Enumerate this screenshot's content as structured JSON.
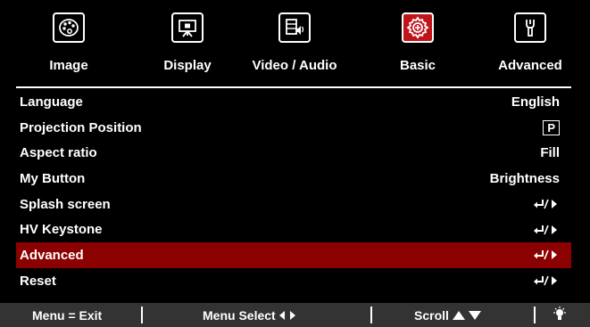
{
  "tabs": [
    {
      "label": "Image",
      "icon": "palette-icon"
    },
    {
      "label": "Display",
      "icon": "projector-screen-icon"
    },
    {
      "label": "Video / Audio",
      "icon": "video-audio-icon"
    },
    {
      "label": "Basic",
      "icon": "gear-icon"
    },
    {
      "label": "Advanced",
      "icon": "wrench-icon"
    }
  ],
  "active_tab": "Basic",
  "rows": [
    {
      "label": "Language",
      "value": "English"
    },
    {
      "label": "Projection Position",
      "value": "P"
    },
    {
      "label": "Aspect ratio",
      "value": "Fill"
    },
    {
      "label": "My Button",
      "value": "Brightness"
    },
    {
      "label": "Splash screen",
      "value": "enter-or-next"
    },
    {
      "label": "HV Keystone",
      "value": "enter-or-next"
    },
    {
      "label": "Advanced",
      "value": "enter-or-next"
    },
    {
      "label": "Reset",
      "value": "enter-or-next"
    }
  ],
  "selected_row": "Advanced",
  "footer": {
    "exit": "Menu = Exit",
    "select": "Menu Select",
    "scroll": "Scroll"
  },
  "colors": {
    "background": "#000000",
    "accent_tab": "#c0141b",
    "selected_row": "#8b0000",
    "footer": "#333333"
  }
}
